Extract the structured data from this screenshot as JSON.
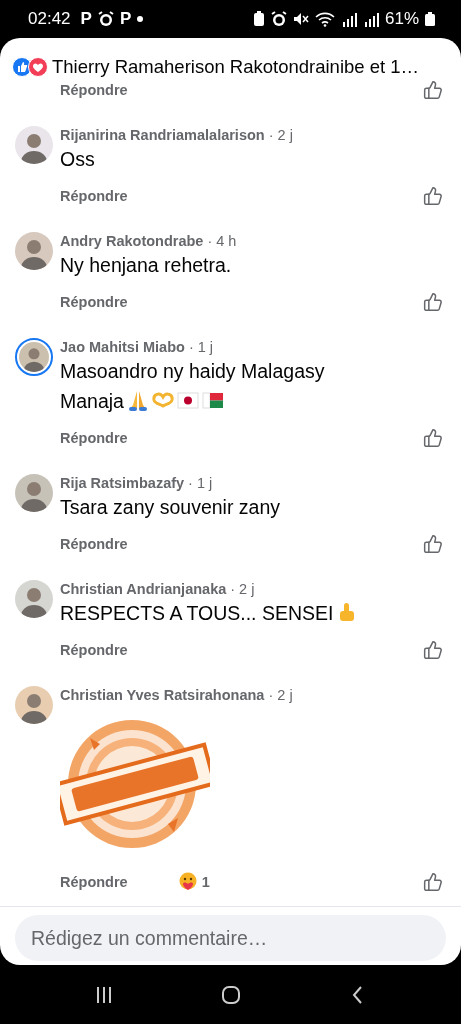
{
  "status_bar": {
    "time": "02:42",
    "left_icons": [
      {
        "kind": "letter",
        "text": "P"
      },
      {
        "kind": "alarm"
      },
      {
        "kind": "letter",
        "text": "P"
      },
      {
        "kind": "dot"
      }
    ],
    "battery_text": "61%"
  },
  "header": {
    "title": "Thierry Ramaherison Rakotondrainibe et 1…"
  },
  "previous_reply": {
    "reply": "Répondre"
  },
  "comments": [
    {
      "author": "Rijanirina Randriamalalarison",
      "time": "· 2 j",
      "text": "Oss",
      "reply": "Répondre",
      "story": false
    },
    {
      "author": "Andry Rakotondrabe",
      "time": "· 4 h",
      "text": "Ny henjana rehetra.",
      "reply": "Répondre",
      "story": false
    },
    {
      "author": "Jao Mahitsi Miabo",
      "time": "· 1 j",
      "text": "Masoandro ny haidy Malagasy Manaja",
      "emojis": [
        {
          "kind": "pray"
        },
        {
          "kind": "heart-hands"
        },
        {
          "kind": "japan-flag"
        },
        {
          "kind": "madagascar-flag"
        }
      ],
      "reply": "Répondre",
      "story": true
    },
    {
      "author": "Rija Ratsimbazafy",
      "time": "· 1 j",
      "text": "Tsara zany souvenir zany",
      "reply": "Répondre",
      "story": false
    },
    {
      "author": "Christian Andrianjanaka",
      "time": "· 2 j",
      "text": "RESPECTS A TOUS... SENSEI",
      "emojis": [
        {
          "kind": "thumbs-up"
        }
      ],
      "reply": "Répondre",
      "story": false
    },
    {
      "author": "Christian Yves Ratsirahonana",
      "time": "· 2 j",
      "reply": "Répondre",
      "reaction_count": "1",
      "story": false
    }
  ],
  "composer": {
    "placeholder": "Rédigez un commentaire…"
  }
}
